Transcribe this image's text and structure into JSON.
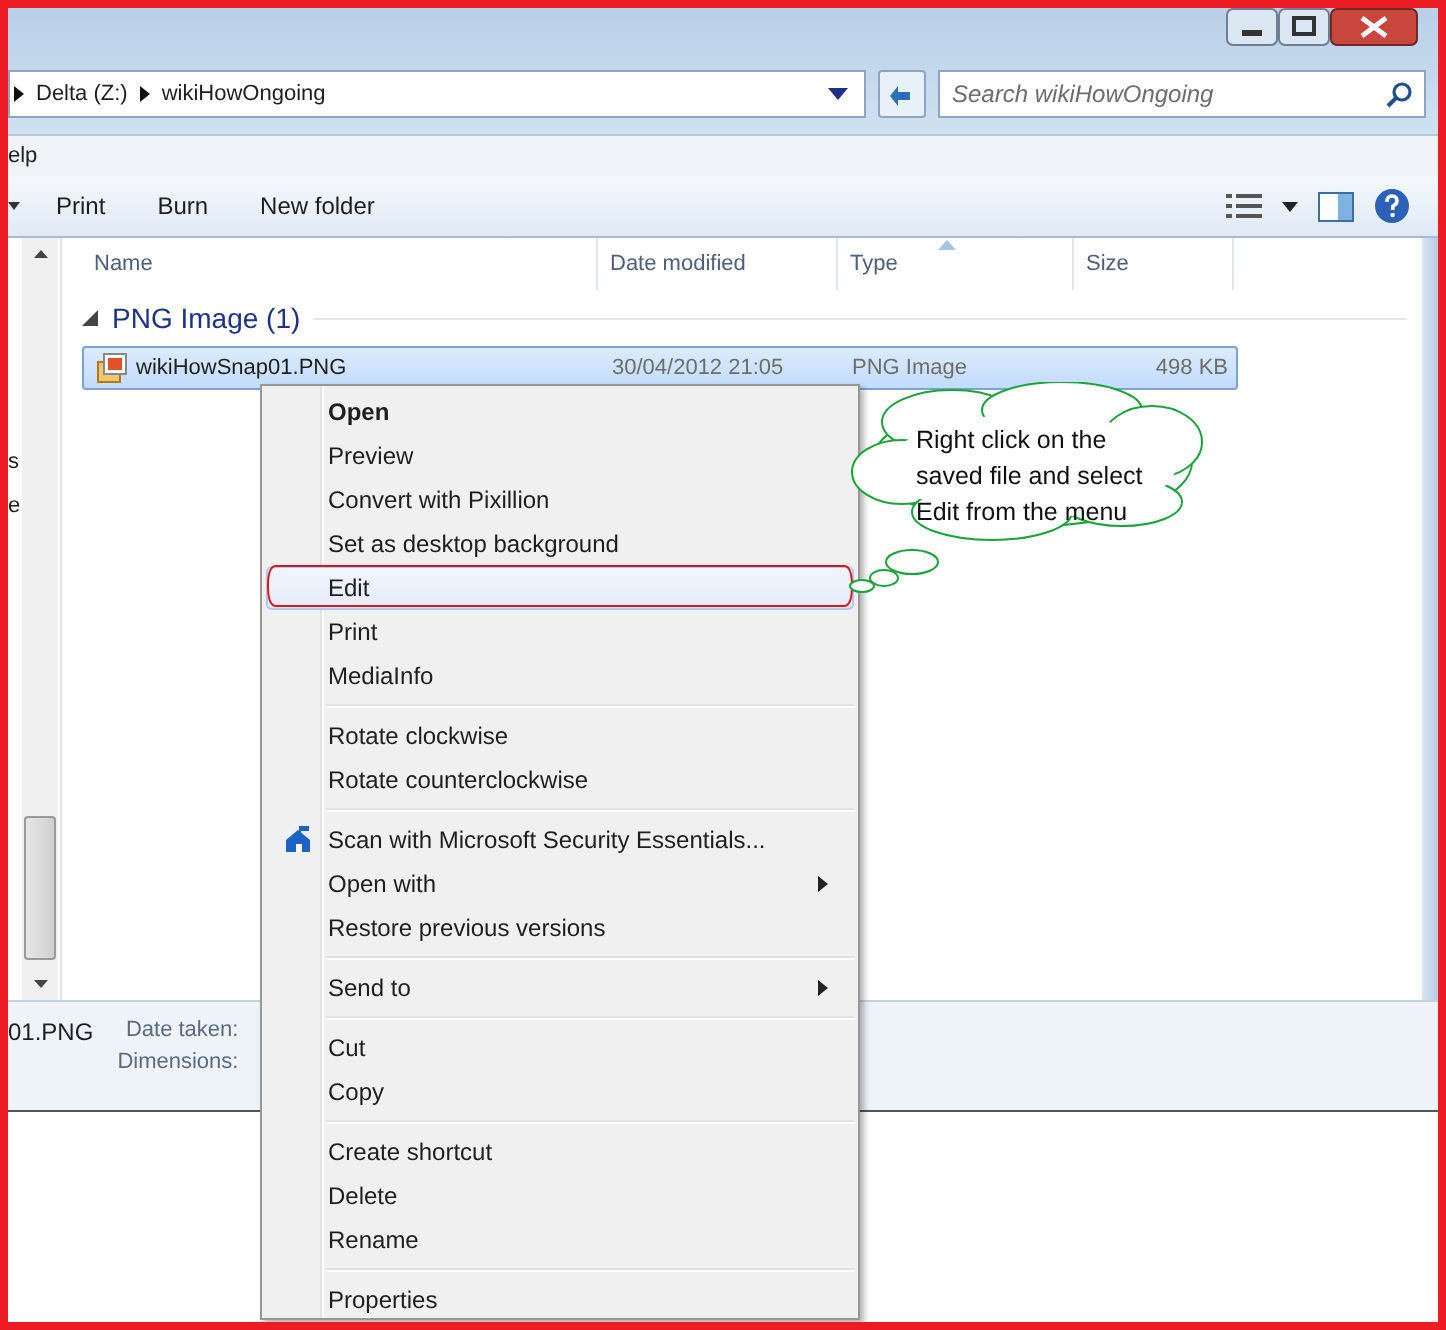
{
  "window": {
    "breadcrumbs": [
      "Delta (Z:)",
      "wikiHowOngoing"
    ],
    "search": {
      "placeholder": "Search wikiHowOngoing"
    }
  },
  "menu_bar": [
    "elp"
  ],
  "toolbar": [
    "Print",
    "Burn",
    "New folder"
  ],
  "nav_fragments": [
    "s",
    "e"
  ],
  "columns": [
    {
      "label": "Name",
      "sorted": false
    },
    {
      "label": "Date modified",
      "sorted": false
    },
    {
      "label": "Type",
      "sorted": true
    },
    {
      "label": "Size",
      "sorted": false
    }
  ],
  "group": {
    "label": "PNG Image (1)",
    "expanded": true
  },
  "files": [
    {
      "name": "wikiHowSnap01.PNG",
      "date": "30/04/2012 21:05",
      "type": "PNG Image",
      "size": "498 KB",
      "selected": true
    }
  ],
  "details": {
    "name": "01.PNG",
    "labels": [
      "Date taken:",
      "Dimensions:"
    ]
  },
  "context_menu": [
    [
      {
        "label": "Open",
        "bold": true,
        "selected": false,
        "submenu": false,
        "icon": false
      },
      {
        "label": "Preview",
        "bold": false,
        "selected": false,
        "submenu": false,
        "icon": false
      },
      {
        "label": "Convert with Pixillion",
        "bold": false,
        "selected": false,
        "submenu": false,
        "icon": false
      },
      {
        "label": "Set as desktop background",
        "bold": false,
        "selected": false,
        "submenu": false,
        "icon": false
      },
      {
        "label": "Edit",
        "bold": false,
        "selected": true,
        "submenu": false,
        "icon": false
      },
      {
        "label": "Print",
        "bold": false,
        "selected": false,
        "submenu": false,
        "icon": false
      },
      {
        "label": "MediaInfo",
        "bold": false,
        "selected": false,
        "submenu": false,
        "icon": false
      }
    ],
    [
      {
        "label": "Rotate clockwise",
        "bold": false,
        "selected": false,
        "submenu": false,
        "icon": false
      },
      {
        "label": "Rotate counterclockwise",
        "bold": false,
        "selected": false,
        "submenu": false,
        "icon": false
      }
    ],
    [
      {
        "label": "Scan with Microsoft Security Essentials...",
        "bold": false,
        "selected": false,
        "submenu": false,
        "icon": true
      },
      {
        "label": "Open with",
        "bold": false,
        "selected": false,
        "submenu": true,
        "icon": false
      },
      {
        "label": "Restore previous versions",
        "bold": false,
        "selected": false,
        "submenu": false,
        "icon": false
      }
    ],
    [
      {
        "label": "Send to",
        "bold": false,
        "selected": false,
        "submenu": true,
        "icon": false
      }
    ],
    [
      {
        "label": "Cut",
        "bold": false,
        "selected": false,
        "submenu": false,
        "icon": false
      },
      {
        "label": "Copy",
        "bold": false,
        "selected": false,
        "submenu": false,
        "icon": false
      }
    ],
    [
      {
        "label": "Create shortcut",
        "bold": false,
        "selected": false,
        "submenu": false,
        "icon": false
      },
      {
        "label": "Delete",
        "bold": false,
        "selected": false,
        "submenu": false,
        "icon": false
      },
      {
        "label": "Rename",
        "bold": false,
        "selected": false,
        "submenu": false,
        "icon": false
      }
    ],
    [
      {
        "label": "Properties",
        "bold": false,
        "selected": false,
        "submenu": false,
        "icon": false
      }
    ]
  ],
  "callout": {
    "lines": [
      "Right click on the",
      "saved file and select",
      "Edit from the menu"
    ]
  }
}
